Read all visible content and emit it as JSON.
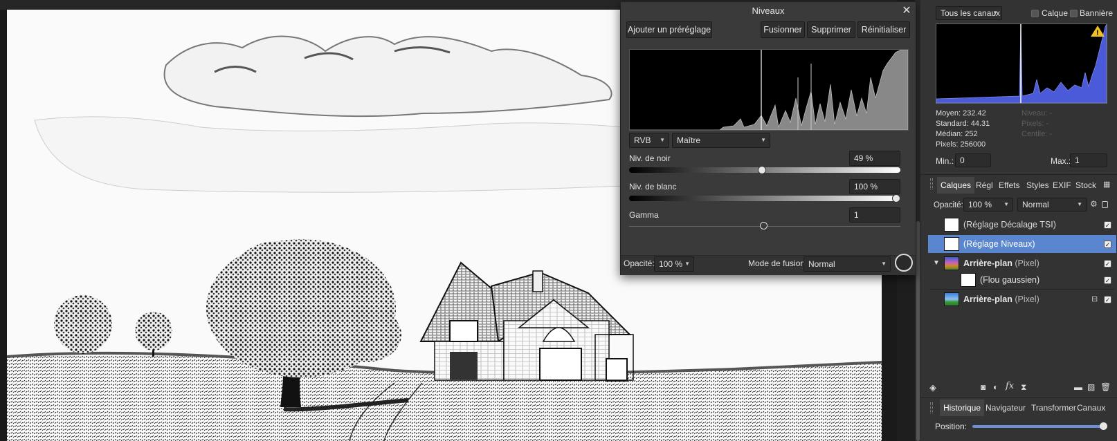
{
  "levels_dialog": {
    "title": "Niveaux",
    "add_preset": "Ajouter un préréglage",
    "merge": "Fusionner",
    "delete": "Supprimer",
    "reset": "Réinitialiser",
    "channel_mode": "RVB",
    "channel": "Maître",
    "black_level_label": "Niv. de noir",
    "black_level_value": "49 %",
    "black_level_fraction": 0.49,
    "white_level_label": "Niv. de blanc",
    "white_level_value": "100 %",
    "white_level_fraction": 1.0,
    "gamma_label": "Gamma",
    "gamma_value": "1",
    "opacity_label": "Opacité:",
    "opacity_value": "100 %",
    "blend_label": "Mode de fusion:",
    "blend_value": "Normal"
  },
  "histogram_panel": {
    "channels": "Tous les canaux",
    "layer_label": "Calque",
    "banner_label": "Bannière",
    "stats_left": [
      {
        "label": "Moyen:",
        "value": "232.42"
      },
      {
        "label": "Standard:",
        "value": "44.31"
      },
      {
        "label": "Médian:",
        "value": "252"
      },
      {
        "label": "Pixels:",
        "value": "256000"
      }
    ],
    "stats_right": [
      {
        "label": "Niveau:",
        "value": "-"
      },
      {
        "label": "Pixels:",
        "value": "-"
      },
      {
        "label": "Centile:",
        "value": "-"
      }
    ],
    "min_label": "Min.:",
    "min_value": "0",
    "max_label": "Max.:",
    "max_value": "1"
  },
  "layers_panel": {
    "tabs": [
      "Calques",
      "Régl",
      "Effets",
      "Styles",
      "EXIF",
      "Stock"
    ],
    "opacity_label": "Opacité:",
    "opacity_value": "100 %",
    "blend_value": "Normal",
    "layers": [
      {
        "name": "(Réglage Décalage TSI)",
        "type": ""
      },
      {
        "name": "(Réglage Niveaux)",
        "type": ""
      },
      {
        "name": "Arrière-plan",
        "type": "(Pixel)"
      },
      {
        "name": "(Flou gaussien)",
        "type": ""
      },
      {
        "name": "Arrière-plan",
        "type": "(Pixel)"
      }
    ]
  },
  "bottom_panel": {
    "tabs": [
      "Historique",
      "Navigateur",
      "Transformer",
      "Canaux"
    ],
    "position_label": "Position:"
  },
  "colors": {
    "selected_layer": "#5a86cf",
    "histogram_blue": "#4a5ad8"
  }
}
